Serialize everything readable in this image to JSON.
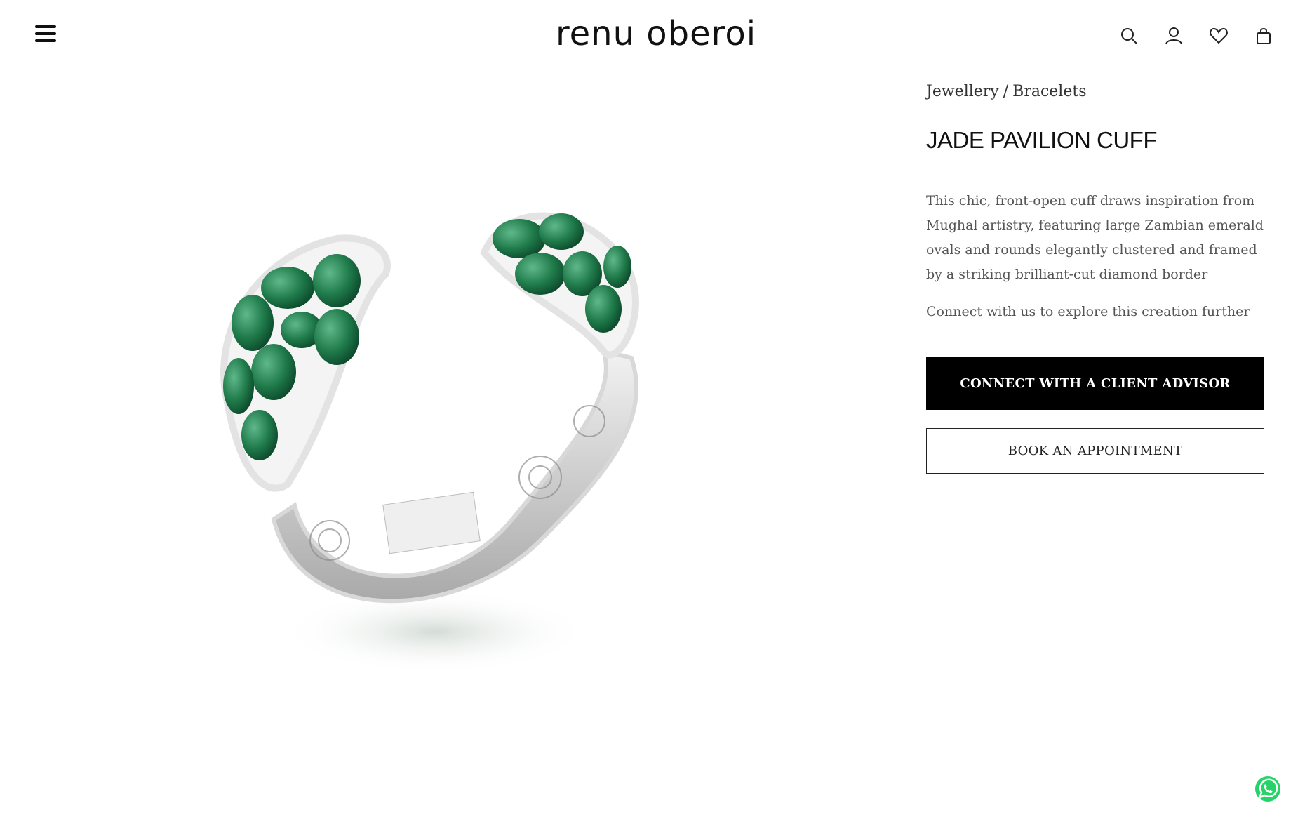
{
  "header": {
    "logo": "renu oberoi",
    "icons": [
      "menu-icon",
      "search-icon",
      "account-icon",
      "wishlist-heart-icon",
      "shopping-bag-icon"
    ]
  },
  "breadcrumb": {
    "category": "Jewellery",
    "separator": "/",
    "subcategory": "Bracelets"
  },
  "product": {
    "title": "JADE PAVILION CUFF",
    "description": "This chic, front-open cuff draws inspiration from Mughal artistry, featuring large Zambian emerald ovals and rounds elegantly clustered and framed by a striking brilliant-cut diamond border",
    "connect_text": "Connect with us to explore this creation further",
    "image": "emerald-diamond-cuff-bracelet"
  },
  "actions": {
    "primary_label": "CONNECT WITH A CLIENT ADVISOR",
    "secondary_label": "BOOK AN APPOINTMENT"
  },
  "floating": {
    "chat_icon": "whatsapp-icon"
  },
  "colors": {
    "emerald": "#1f7a4a",
    "primary_button": "#000000",
    "whatsapp": "#25D366"
  }
}
